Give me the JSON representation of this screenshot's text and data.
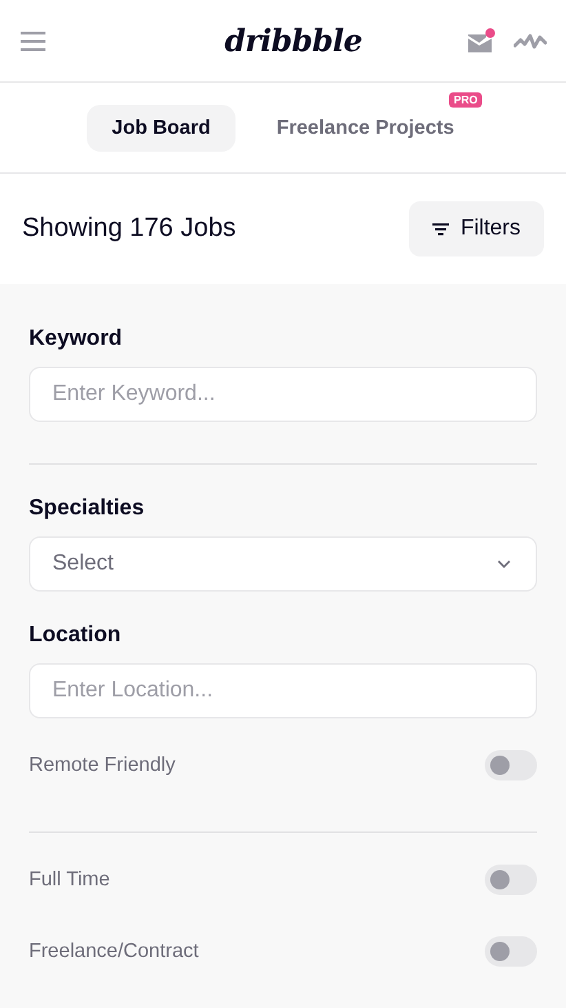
{
  "header": {
    "logo": "dribbble",
    "has_notification": true
  },
  "tabs": [
    {
      "label": "Job Board",
      "selected": true
    },
    {
      "label": "Freelance Projects",
      "selected": false,
      "badge": "PRO"
    }
  ],
  "results": {
    "title": "Showing 176 Jobs",
    "filters_button": "Filters"
  },
  "filter_groups": [
    {
      "items": [
        {
          "kind": "text",
          "label": "Keyword",
          "placeholder": "Enter Keyword..."
        }
      ]
    },
    {
      "items": [
        {
          "kind": "select",
          "label": "Specialties",
          "placeholder": "Select"
        },
        {
          "kind": "text",
          "label": "Location",
          "placeholder": "Enter Location..."
        },
        {
          "kind": "toggle",
          "label": "Remote Friendly",
          "on": false
        }
      ]
    },
    {
      "items": [
        {
          "kind": "toggle",
          "label": "Full Time",
          "on": false
        },
        {
          "kind": "toggle",
          "label": "Freelance/Contract",
          "on": false
        }
      ]
    }
  ]
}
